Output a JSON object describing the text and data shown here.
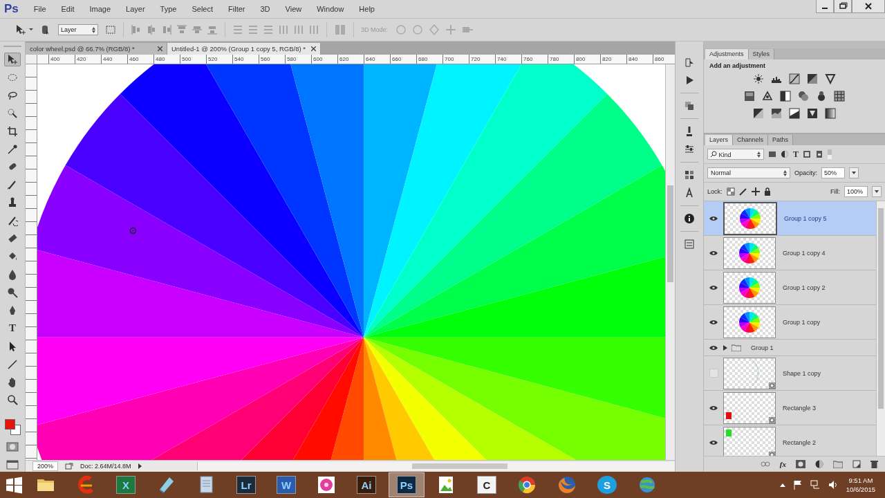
{
  "menu": {
    "logo": "Ps",
    "items": [
      "File",
      "Edit",
      "Image",
      "Layer",
      "Type",
      "Select",
      "Filter",
      "3D",
      "View",
      "Window",
      "Help"
    ]
  },
  "options_bar": {
    "layer_select": "Layer",
    "mode_label": "3D Mode:"
  },
  "doc_tabs": [
    {
      "label": "color wheel.psd @ 66.7% (RGB/8) *",
      "selected": false
    },
    {
      "label": "Untitled-1 @ 200% (Group 1 copy 5, RGB/8) *",
      "selected": true
    }
  ],
  "ruler": [
    "400",
    "420",
    "440",
    "460",
    "480",
    "500",
    "520",
    "540",
    "560",
    "580",
    "600",
    "620",
    "640",
    "660",
    "680",
    "700",
    "720",
    "740",
    "760",
    "780",
    "800",
    "820",
    "840",
    "860"
  ],
  "tools": [
    {
      "kind": "move",
      "selected": true
    },
    {
      "kind": "marquee",
      "selected": false
    },
    {
      "kind": "lasso",
      "selected": false
    },
    {
      "kind": "quick-select",
      "selected": false
    },
    {
      "kind": "crop",
      "selected": false
    },
    {
      "kind": "eyedropper",
      "selected": false
    },
    {
      "kind": "healing",
      "selected": false
    },
    {
      "kind": "brush",
      "selected": false
    },
    {
      "kind": "stamp",
      "selected": false
    },
    {
      "kind": "history-brush",
      "selected": false
    },
    {
      "kind": "eraser",
      "selected": false
    },
    {
      "kind": "bucket",
      "selected": false
    },
    {
      "kind": "blur",
      "selected": false
    },
    {
      "kind": "dodge",
      "selected": false
    },
    {
      "kind": "pen",
      "selected": false
    },
    {
      "kind": "type",
      "label": "T",
      "selected": false
    },
    {
      "kind": "path-select",
      "selected": false
    },
    {
      "kind": "line",
      "selected": false
    },
    {
      "kind": "hand",
      "selected": false
    },
    {
      "kind": "zoom",
      "selected": false
    }
  ],
  "color_swatches": [
    {
      "kind": "foreground",
      "color": "#e8140c"
    },
    {
      "kind": "background",
      "color": "#ffffff"
    }
  ],
  "status_bar": {
    "zoom": "200%",
    "doc_size": "Doc: 2.64M/14.8M"
  },
  "adjustments_panel": {
    "tabs": [
      {
        "label": "Adjustments",
        "selected": true
      },
      {
        "label": "Styles",
        "selected": false
      }
    ],
    "heading": "Add an adjustment"
  },
  "layers_panel": {
    "tabs": [
      {
        "label": "Layers",
        "selected": true
      },
      {
        "label": "Channels",
        "selected": false
      },
      {
        "label": "Paths",
        "selected": false
      }
    ],
    "filter": "Kind",
    "filter_type_glyph": "T",
    "blend_mode": "Normal",
    "opacity_label": "Opacity:",
    "opacity": "50%",
    "lock_label": "Lock:",
    "fill_label": "Fill:",
    "fill": "100%",
    "fx_label": "fx",
    "layers": [
      {
        "name": "Group 1 copy 5",
        "kind": "wheel",
        "visible": true,
        "selected": true
      },
      {
        "name": "Group 1 copy 4",
        "kind": "wheel",
        "visible": true,
        "selected": false
      },
      {
        "name": "Group 1 copy 2",
        "kind": "wheel",
        "visible": true,
        "selected": false
      },
      {
        "name": "Group 1 copy",
        "kind": "wheel",
        "visible": true,
        "selected": false
      },
      {
        "name": "Group 1",
        "kind": "group",
        "visible": true,
        "selected": false,
        "expanded": false
      },
      {
        "name": "Shape 1 copy",
        "kind": "shape",
        "visible": false,
        "selected": false
      },
      {
        "name": "Rectangle 3",
        "kind": "rect",
        "color": "#e01010",
        "visible": true,
        "selected": false
      },
      {
        "name": "Rectangle 2",
        "kind": "rect",
        "color": "#22e02a",
        "visible": true,
        "selected": false
      }
    ]
  },
  "taskbar": {
    "apps": [
      {
        "kind": "folder",
        "active": false
      },
      {
        "kind": "swirl",
        "active": false
      },
      {
        "kind": "tile",
        "label": "X",
        "color": "#1d7a3e",
        "active": false
      },
      {
        "kind": "notepad",
        "active": false
      },
      {
        "kind": "document",
        "active": false
      },
      {
        "kind": "tile",
        "label": "Lr",
        "color": "#1c2b3a",
        "active": false
      },
      {
        "kind": "tile",
        "label": "W",
        "color": "#2a5cad",
        "active": false
      },
      {
        "kind": "flower",
        "active": false
      },
      {
        "kind": "tile",
        "label": "Ai",
        "color": "#3a1d08",
        "active": false
      },
      {
        "kind": "tile",
        "label": "Ps",
        "color": "#0d2a45",
        "active": true
      },
      {
        "kind": "photo",
        "active": false
      },
      {
        "kind": "tile",
        "label": "C",
        "color": "#f4f4f4",
        "active": false
      },
      {
        "kind": "ring",
        "active": false
      },
      {
        "kind": "fox",
        "active": false
      },
      {
        "kind": "round-tile",
        "label": "S",
        "color": "#1ea0e0",
        "active": false
      },
      {
        "kind": "globe",
        "active": false
      }
    ],
    "time": "9:51 AM",
    "date": "10/6/2015"
  }
}
